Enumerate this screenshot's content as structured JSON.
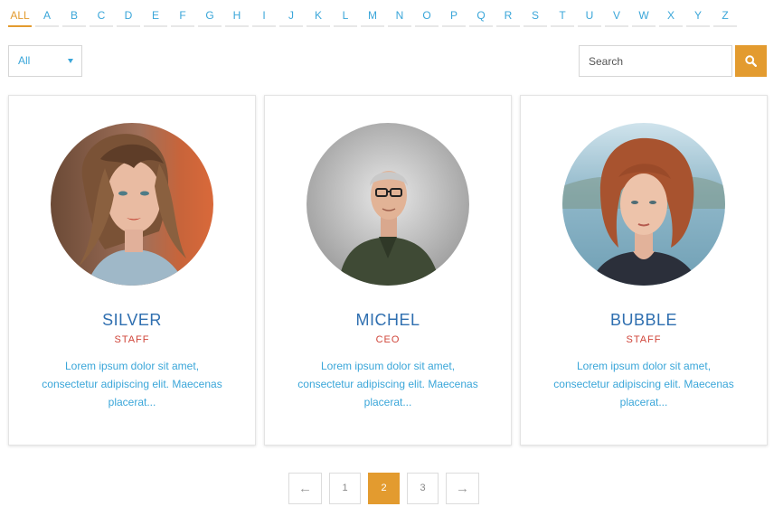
{
  "filter": {
    "letters": [
      "ALL",
      "A",
      "B",
      "C",
      "D",
      "E",
      "F",
      "G",
      "H",
      "I",
      "J",
      "K",
      "L",
      "M",
      "N",
      "O",
      "P",
      "Q",
      "R",
      "S",
      "T",
      "U",
      "V",
      "W",
      "X",
      "Y",
      "Z"
    ],
    "active_letter": "ALL"
  },
  "role_select": {
    "selected": "All"
  },
  "search": {
    "placeholder": "Search",
    "button_icon": "search-icon"
  },
  "cards": [
    {
      "name": "SILVER",
      "role": "STAFF",
      "description": "Lorem ipsum dolor sit amet, consectetur adipiscing elit. Maecenas placerat...",
      "photo": "woman-windswept-hair"
    },
    {
      "name": "MICHEL",
      "role": "CEO",
      "description": "Lorem ipsum dolor sit amet, consectetur adipiscing elit. Maecenas placerat...",
      "photo": "man-glasses-green-shirt"
    },
    {
      "name": "BUBBLE",
      "role": "STAFF",
      "description": "Lorem ipsum dolor sit amet, consectetur adipiscing elit. Maecenas placerat...",
      "photo": "woman-red-bob-hair"
    }
  ],
  "pagination": {
    "prev_label": "←",
    "next_label": "→",
    "pages": [
      "1",
      "2",
      "3"
    ],
    "current_page": "2"
  },
  "colors": {
    "accent": "#e39b2f",
    "link": "#3aa6d9",
    "name": "#2f6fb0",
    "role": "#d0453a"
  }
}
